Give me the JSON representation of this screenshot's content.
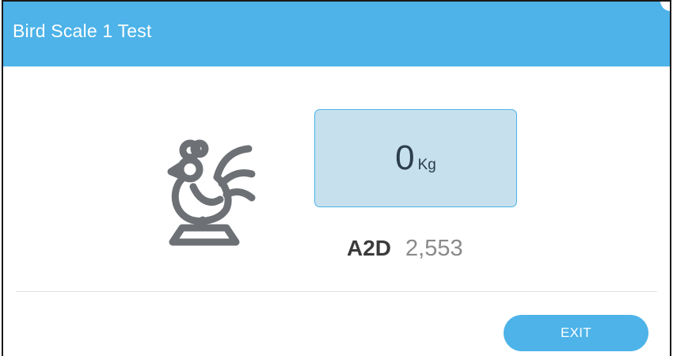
{
  "dialog": {
    "title": "Bird Scale 1 Test"
  },
  "icon": {
    "name": "bird-on-scale-icon",
    "color": "#6d7175"
  },
  "weight": {
    "value": "0",
    "unit": "Kg"
  },
  "a2d": {
    "label": "A2D",
    "value": "2,553"
  },
  "actions": {
    "exit_label": "EXIT"
  },
  "colors": {
    "accent": "#4db3e8",
    "weight_box_bg": "#c6e0ee",
    "text_dark": "#3b3b3b",
    "text_muted": "#8a8a8a"
  }
}
